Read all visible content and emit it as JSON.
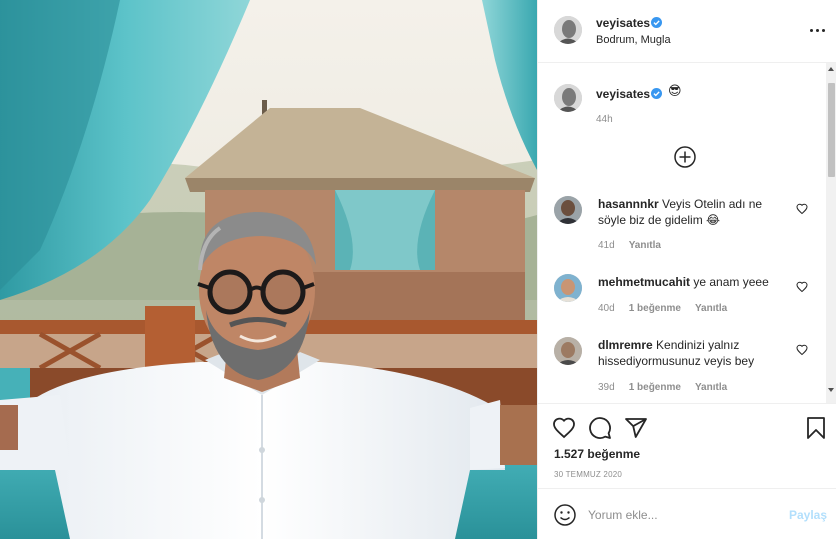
{
  "post": {
    "username": "veyisates",
    "location": "Bodrum, Mugla"
  },
  "caption": {
    "username": "veyisates",
    "emoji": "😎",
    "time": "44h"
  },
  "comments": [
    {
      "username": "hasannnkr",
      "text": "Veyis Otelin adı ne söyle biz de gidelim 😂",
      "time": "41d",
      "likes": "",
      "reply": "Yanıtla"
    },
    {
      "username": "mehmetmucahit",
      "text": "ye anam yeee",
      "time": "40d",
      "likes": "1 beğenme",
      "reply": "Yanıtla"
    },
    {
      "username": "dlmremre",
      "text": "Kendinizi yalnız hissediyormusunuz veyis bey",
      "time": "39d",
      "likes": "1 beğenme",
      "reply": "Yanıtla"
    }
  ],
  "actions": {
    "likes": "1.527 beğenme",
    "date": "30 TEMMUZ 2020"
  },
  "add_comment": {
    "placeholder": "Yorum ekle...",
    "post_label": "Paylaş"
  },
  "colors": {
    "verified": "#3897f0",
    "secondary_text": "#8e8e8e",
    "post_button_disabled": "#b2dffc",
    "curtain": "#4fb6bd"
  },
  "icons": {
    "more": "more-horizontal-icon",
    "load_more": "plus-circle-icon",
    "like": "heart-icon",
    "comment": "speech-bubble-icon",
    "share": "paper-plane-icon",
    "save": "bookmark-icon",
    "emoji": "smiley-icon"
  }
}
